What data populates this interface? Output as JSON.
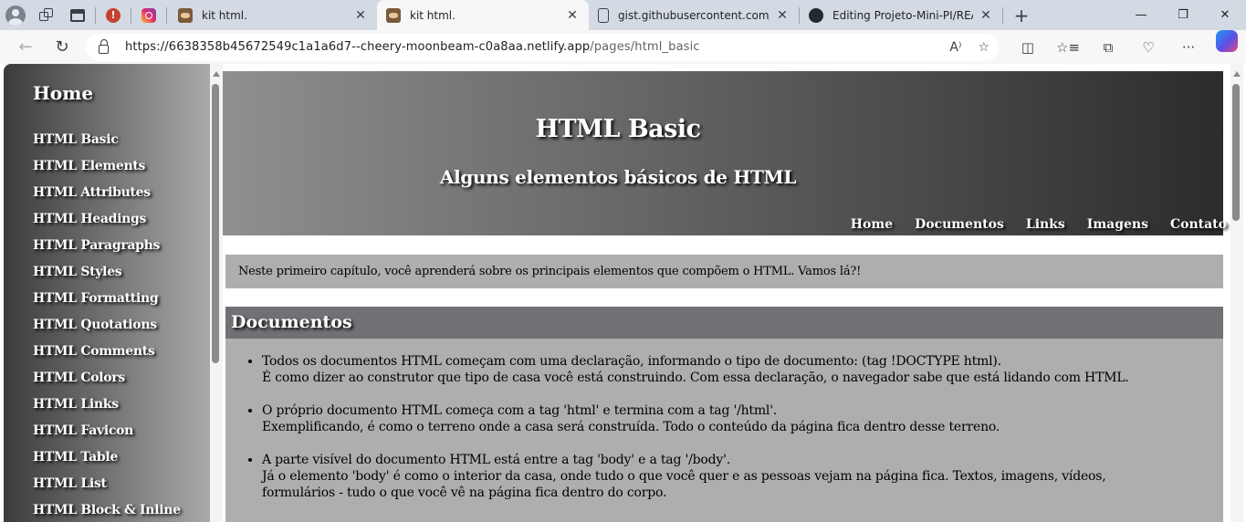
{
  "browser": {
    "tabs": [
      {
        "label": "kit html.",
        "active": false,
        "icon": "tiger-favicon"
      },
      {
        "label": "kit html.",
        "active": true,
        "icon": "tiger-favicon"
      },
      {
        "label": "gist.githubusercontent.com/loh",
        "active": false,
        "icon": "document-icon"
      },
      {
        "label": "Editing Projeto-Mini-PI/READM",
        "active": false,
        "icon": "github-icon"
      }
    ],
    "url_host": "https://6638358b45672549c1a1a6d7--cheery-moonbeam-c0a8aa.netlify.app",
    "url_path": "/pages/html_basic",
    "accent": "#1f9bf0"
  },
  "sidebar": {
    "home": "Home",
    "items": [
      "HTML Basic",
      "HTML Elements",
      "HTML Attributes",
      "HTML Headings",
      "HTML Paragraphs",
      "HTML Styles",
      "HTML Formatting",
      "HTML Quotations",
      "HTML Comments",
      "HTML Colors",
      "HTML Links",
      "HTML Favicon",
      "HTML Table",
      "HTML List",
      "HTML Block & Inline"
    ]
  },
  "header": {
    "title": "HTML Basic",
    "subtitle": "Alguns elementos básicos de HTML",
    "nav": [
      "Home",
      "Documentos",
      "Links",
      "Imagens",
      "Contato"
    ]
  },
  "intro": "Neste primeiro capítulo, você aprenderá sobre os principais elementos que compõem o HTML. Vamos lá?!",
  "section": {
    "title": "Documentos",
    "items": [
      {
        "line1": "Todos os documentos HTML começam com uma declaração, informando o tipo de documento: (tag !DOCTYPE html).",
        "line2": "É como dizer ao construtor que tipo de casa você está construindo. Com essa declaração, o navegador sabe que está lidando com HTML."
      },
      {
        "line1": "O próprio documento HTML começa com a tag 'html' e termina com a tag '/html'.",
        "line2": "Exemplificando, é como o terreno onde a casa será construída. Todo o conteúdo da página fica dentro desse terreno."
      },
      {
        "line1": "A parte visível do documento HTML está entre a tag 'body' e a tag '/body'.",
        "line2": "Já o elemento 'body' é como o interior da casa, onde tudo o que você quer e as pessoas vejam na página fica. Textos, imagens, vídeos,",
        "line3": "formulários - tudo o que você vê na página fica dentro do corpo."
      }
    ]
  }
}
